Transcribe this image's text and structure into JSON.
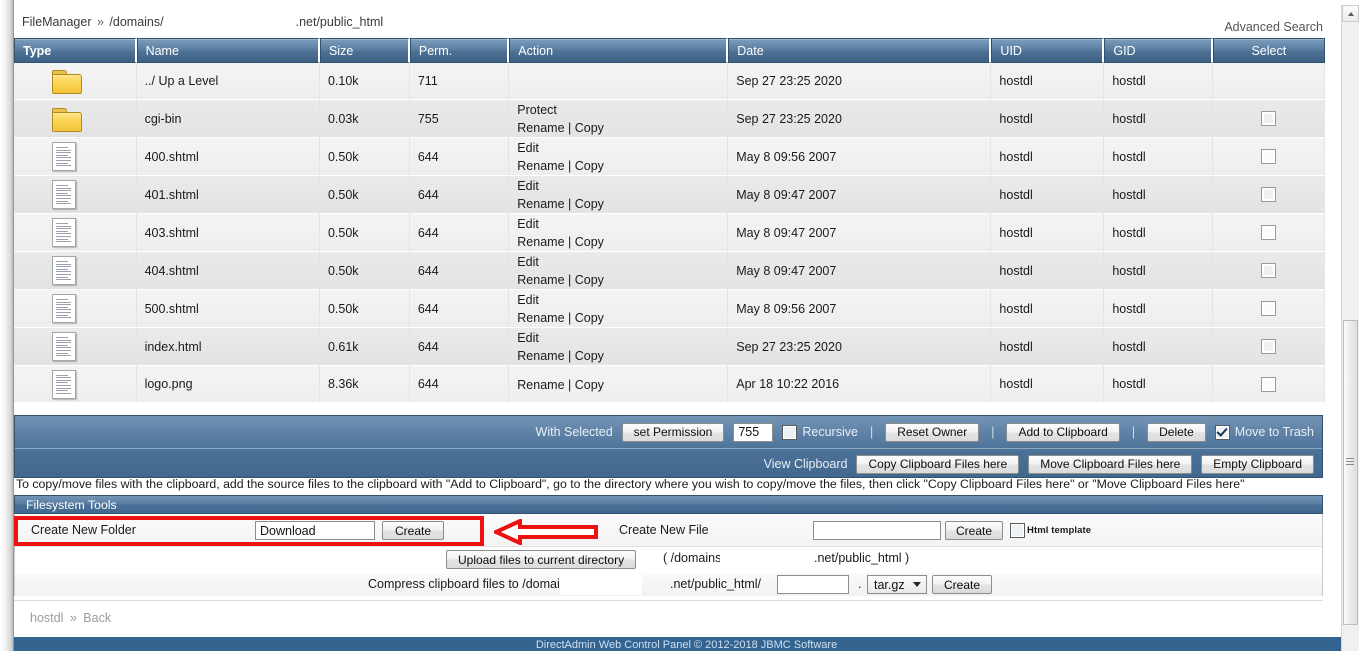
{
  "breadcrumb": {
    "app": "FileManager",
    "separator": "»",
    "path_prefix": "/domains/",
    "path_suffix": ".net/public_html"
  },
  "advanced_search": "Advanced Search",
  "table": {
    "columns": [
      "Type",
      "Name",
      "Size",
      "Perm.",
      "Action",
      "Date",
      "UID",
      "GID",
      "Select"
    ],
    "rows": [
      {
        "icon": "folder-icon",
        "name": "../ Up a Level",
        "size": "0.10k",
        "perm": "711",
        "action1": "",
        "action2": "",
        "date": "Sep 27 23:25 2020",
        "uid": "hostdl",
        "gid": "hostdl",
        "select": false,
        "has_checkbox": false
      },
      {
        "icon": "folder-icon",
        "name": "cgi-bin",
        "size": "0.03k",
        "perm": "755",
        "action1": "Protect",
        "action2": "Rename | Copy",
        "date": "Sep 27 23:25 2020",
        "uid": "hostdl",
        "gid": "hostdl",
        "select": false,
        "has_checkbox": true
      },
      {
        "icon": "file-icon",
        "name": "400.shtml",
        "size": "0.50k",
        "perm": "644",
        "action1": "Edit",
        "action2": "Rename | Copy",
        "date": "May 8 09:56 2007",
        "uid": "hostdl",
        "gid": "hostdl",
        "select": false,
        "has_checkbox": true
      },
      {
        "icon": "file-icon",
        "name": "401.shtml",
        "size": "0.50k",
        "perm": "644",
        "action1": "Edit",
        "action2": "Rename | Copy",
        "date": "May 8 09:47 2007",
        "uid": "hostdl",
        "gid": "hostdl",
        "select": false,
        "has_checkbox": true
      },
      {
        "icon": "file-icon",
        "name": "403.shtml",
        "size": "0.50k",
        "perm": "644",
        "action1": "Edit",
        "action2": "Rename | Copy",
        "date": "May 8 09:47 2007",
        "uid": "hostdl",
        "gid": "hostdl",
        "select": false,
        "has_checkbox": true
      },
      {
        "icon": "file-icon",
        "name": "404.shtml",
        "size": "0.50k",
        "perm": "644",
        "action1": "Edit",
        "action2": "Rename | Copy",
        "date": "May 8 09:47 2007",
        "uid": "hostdl",
        "gid": "hostdl",
        "select": false,
        "has_checkbox": true
      },
      {
        "icon": "file-icon",
        "name": "500.shtml",
        "size": "0.50k",
        "perm": "644",
        "action1": "Edit",
        "action2": "Rename | Copy",
        "date": "May 8 09:56 2007",
        "uid": "hostdl",
        "gid": "hostdl",
        "select": false,
        "has_checkbox": true
      },
      {
        "icon": "file-icon",
        "name": "index.html",
        "size": "0.61k",
        "perm": "644",
        "action1": "Edit",
        "action2": "Rename | Copy",
        "date": "Sep 27 23:25 2020",
        "uid": "hostdl",
        "gid": "hostdl",
        "select": false,
        "has_checkbox": true
      },
      {
        "icon": "file-icon",
        "name": "logo.png",
        "size": "8.36k",
        "perm": "644",
        "action1": "",
        "action2": "Rename | Copy",
        "date": "Apr 18 10:22 2016",
        "uid": "hostdl",
        "gid": "hostdl",
        "select": false,
        "has_checkbox": true
      }
    ]
  },
  "actions": {
    "with_selected_label": "With Selected",
    "set_permission_button": "set Permission",
    "permission_value": "755",
    "recursive_label": "Recursive",
    "recursive_checked": false,
    "reset_owner_button": "Reset Owner",
    "add_to_clipboard_button": "Add to Clipboard",
    "delete_button": "Delete",
    "move_to_trash_label": "Move to Trash",
    "move_to_trash_checked": true,
    "separator": "|",
    "view_clipboard_label": "View Clipboard",
    "copy_clipboard_button": "Copy Clipboard Files here",
    "move_clipboard_button": "Move Clipboard Files here",
    "empty_clipboard_button": "Empty Clipboard"
  },
  "note": "To copy/move files with the clipboard, add the source files to the clipboard with \"Add to Clipboard\", go to the directory where you wish to copy/move the files, then click \"Copy Clipboard Files here\" or \"Move Clipboard Files here\"",
  "filesystem_tools": {
    "title": "Filesystem Tools",
    "create_folder_label": "Create New Folder",
    "create_folder_value": "Download",
    "create_folder_button": "Create",
    "create_file_label": "Create New File",
    "create_file_value": "",
    "create_file_button": "Create",
    "html_template_label": "Html template",
    "html_template_checked": false,
    "upload_button": "Upload files to current directory",
    "upload_path_open": "( /domains/",
    "upload_path_suffix": ".net/public_html )",
    "compress_label": "Compress clipboard files to /domains/",
    "compress_path_suffix": ".net/public_html/",
    "compress_name_value": "",
    "compress_dot": ".",
    "compress_format": "tar.gz",
    "compress_button": "Create"
  },
  "footer": {
    "user": "hostdl",
    "separator": "»",
    "back": "Back",
    "copyright": "DirectAdmin Web Control Panel © 2012-2018 JBMC Software"
  },
  "annotation": {
    "highlight_color": "#ee1111",
    "shape": "left-arrow",
    "target": "create-new-folder-row"
  }
}
